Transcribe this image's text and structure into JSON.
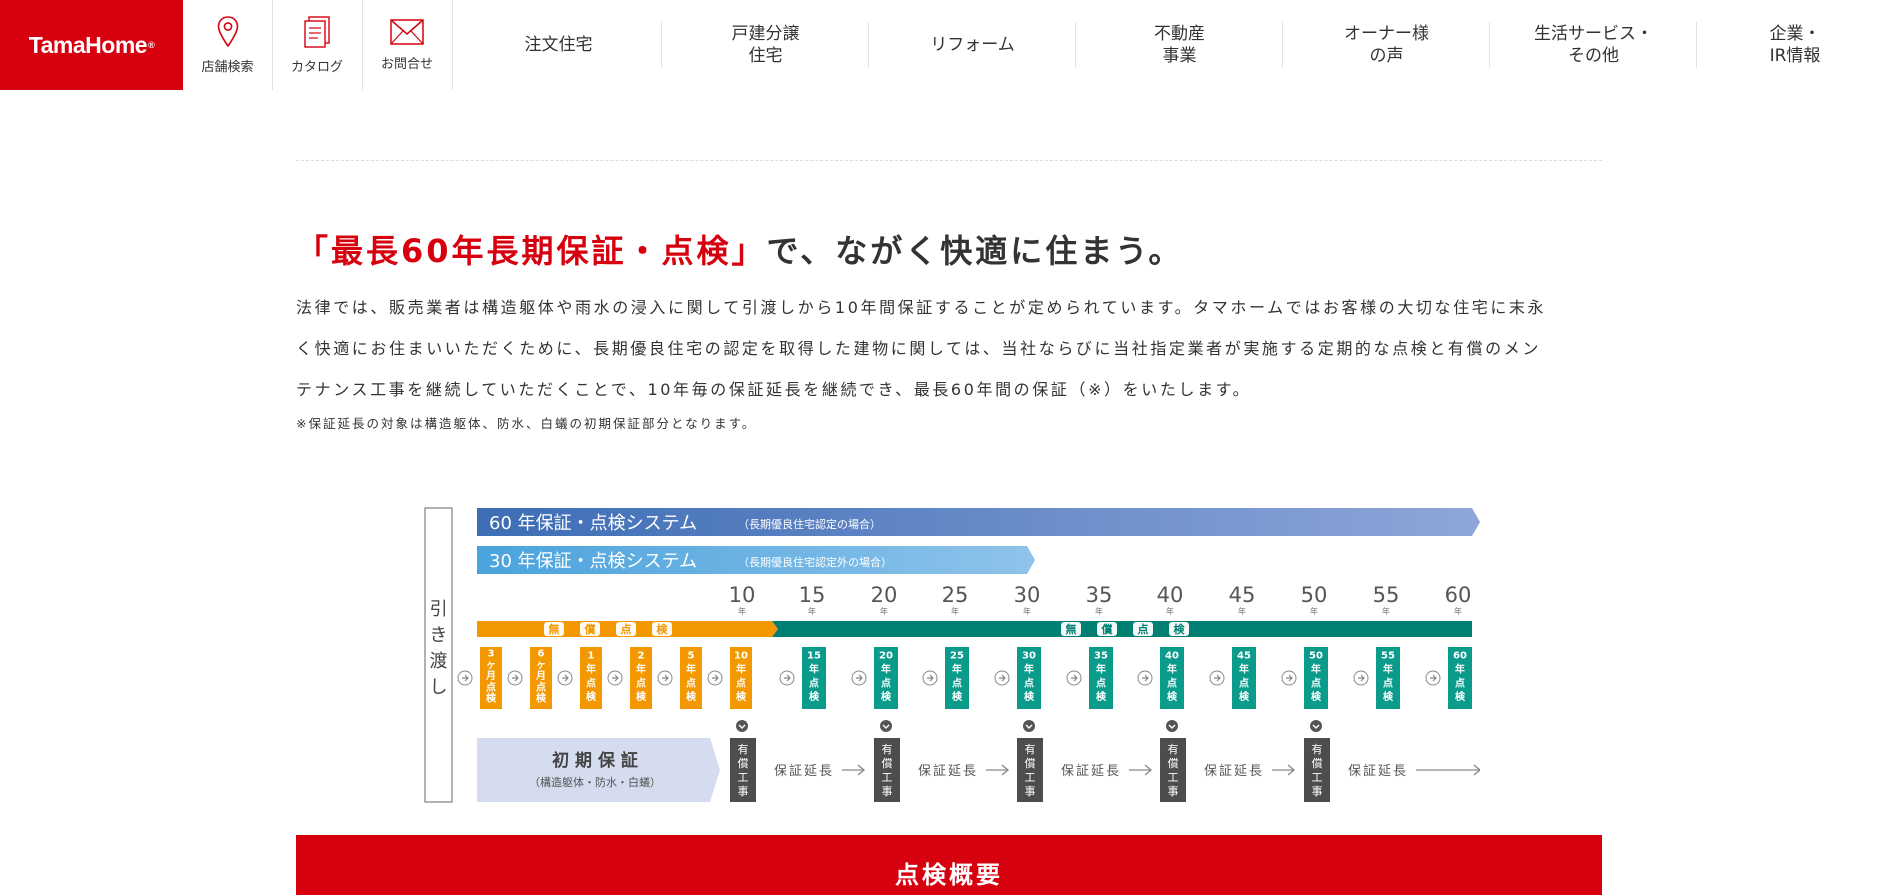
{
  "header": {
    "logo_text": "TamaHome",
    "logo_mark": "®",
    "utility": [
      {
        "label": "店舗検索",
        "icon": "map-pin-icon"
      },
      {
        "label": "カタログ",
        "icon": "catalog-icon"
      },
      {
        "label": "お問合せ",
        "icon": "mail-icon"
      }
    ],
    "nav": [
      {
        "line1": "注文住宅",
        "line2": ""
      },
      {
        "line1": "戸建分譲",
        "line2": "住宅"
      },
      {
        "line1": "リフォーム",
        "line2": ""
      },
      {
        "line1": "不動産",
        "line2": "事業"
      },
      {
        "line1": "オーナー様",
        "line2": "の声"
      },
      {
        "line1": "生活サービス・",
        "line2": "その他"
      },
      {
        "line1": "企業・",
        "line2": "IR情報"
      }
    ]
  },
  "main": {
    "headline_red": "「最長60年長期保証・点検」",
    "headline_rest": "で、ながく快適に住まう。",
    "body_lines": [
      "法律では、販売業者は構造躯体や雨水の浸入に関して引渡しから10年間保証することが定められています。タマホームではお客様の大切な住宅に末永",
      "く快適にお住まいいただくために、長期優良住宅の認定を取得した建物に関しては、当社ならびに当社指定業者が実施する定期的な点検と有償のメン",
      "テナンス工事を継続していただくことで、10年毎の保証延長を継続でき、最長60年間の保証（※）をいたします。"
    ],
    "note": "※保証延長の対象は構造躯体、防水、白蟻の初期保証部分となります。"
  },
  "diagram": {
    "bar60_title": "60 年保証・点検システム",
    "bar60_sub": "（長期優良住宅認定の場合）",
    "bar30_title": "30 年保証・点検システム",
    "bar30_sub": "（長期優良住宅認定外の場合）",
    "handover": [
      "引",
      "き",
      "渡",
      "し"
    ],
    "year_numbers": [
      "10",
      "15",
      "20",
      "25",
      "30",
      "35",
      "40",
      "45",
      "50",
      "55",
      "60"
    ],
    "year_unit": "年",
    "free_inspection_chars": [
      "無",
      "償",
      "点",
      "検"
    ],
    "orange_boxes": [
      [
        "3",
        "ヶ",
        "月",
        "点",
        "検"
      ],
      [
        "6",
        "ヶ",
        "月",
        "点",
        "検"
      ],
      [
        "1",
        "年",
        "点",
        "検"
      ],
      [
        "2",
        "年",
        "点",
        "検"
      ],
      [
        "5",
        "年",
        "点",
        "検"
      ],
      [
        "10",
        "年",
        "点",
        "検"
      ]
    ],
    "teal_boxes": [
      [
        "15",
        "年",
        "点",
        "検"
      ],
      [
        "20",
        "年",
        "点",
        "検"
      ],
      [
        "25",
        "年",
        "点",
        "検"
      ],
      [
        "30",
        "年",
        "点",
        "検"
      ],
      [
        "35",
        "年",
        "点",
        "検"
      ],
      [
        "40",
        "年",
        "点",
        "検"
      ],
      [
        "45",
        "年",
        "点",
        "検"
      ],
      [
        "50",
        "年",
        "点",
        "検"
      ],
      [
        "55",
        "年",
        "点",
        "検"
      ],
      [
        "60",
        "年",
        "点",
        "検"
      ]
    ],
    "initial_title": "初 期 保 証",
    "initial_sub": "（構造躯体・防水・白蟻）",
    "paid_work": [
      "有",
      "償",
      "工",
      "事"
    ],
    "extension_label": "保証延長",
    "colors": {
      "orange": "#f39800",
      "teal": "#0a9b8b",
      "teal_dark": "#007f73",
      "blue_dark": "#3d6db5",
      "blue_light": "#8fc3ea",
      "gray_box": "#4d4d4d",
      "initial_bg": "#d6dcf0"
    }
  },
  "section": {
    "next_heading": "点検概要"
  }
}
